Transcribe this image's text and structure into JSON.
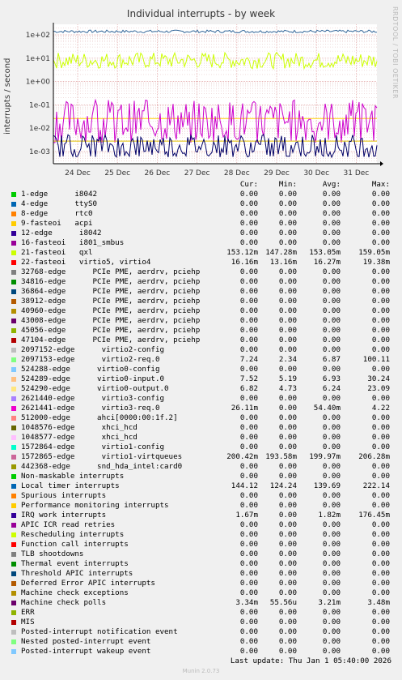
{
  "chart_data": {
    "type": "line",
    "title": "Individual interrupts - by week",
    "ylabel": "interrupts / second",
    "yscale": "log",
    "ylim": [
      0.0006,
      0.3
    ],
    "yticks": [
      "1e+02",
      "1e+01",
      "1e+00",
      "1e-01",
      "1e-02",
      "1e-03"
    ],
    "xticks": [
      "24 Dec",
      "25 Dec",
      "26 Dec",
      "27 Dec",
      "28 Dec",
      "29 Dec",
      "30 Dec",
      "31 Dec"
    ],
    "series": [
      {
        "name": "Local timer interrupts",
        "color": "#336699",
        "level": 140,
        "noise": 0.06
      },
      {
        "name": "21-fasteoi qxl",
        "color": "#ccff00",
        "level": 8,
        "noise": 0.35
      },
      {
        "name": "2621441-edge virtio3-req.0",
        "color": "#ffcc00",
        "level": 0.026,
        "noise": 0
      },
      {
        "name": "1572865-edge virtio1-virtqueues",
        "color": "#cc00cc",
        "level": 0.02,
        "noise": 0.9
      },
      {
        "name": "2621440-edge virtio3-config",
        "color": "#e4c200",
        "level": 0.0028,
        "noise": 0
      },
      {
        "name": "IRQ work interrupts",
        "color": "#000066",
        "level": 0.0018,
        "noise": 0.5
      }
    ]
  },
  "side_label": "RRDTOOL / TOBI OETIKER",
  "headers": {
    "cur": "Cur:",
    "min": "Min:",
    "avg": "Avg:",
    "max": "Max:"
  },
  "rows": [
    {
      "label": "1-edge      i8042",
      "color": "#00cc00",
      "cur": "0.00",
      "min": "0.00",
      "avg": "0.00",
      "max": "0.00"
    },
    {
      "label": "4-edge      ttyS0",
      "color": "#0066b3",
      "cur": "0.00",
      "min": "0.00",
      "avg": "0.00",
      "max": "0.00"
    },
    {
      "label": "8-edge      rtc0",
      "color": "#ff8000",
      "cur": "0.00",
      "min": "0.00",
      "avg": "0.00",
      "max": "0.00"
    },
    {
      "label": "9-fasteoi   acpi",
      "color": "#ffcc00",
      "cur": "0.00",
      "min": "0.00",
      "avg": "0.00",
      "max": "0.00"
    },
    {
      "label": "12-edge      i8042",
      "color": "#330099",
      "cur": "0.00",
      "min": "0.00",
      "avg": "0.00",
      "max": "0.00"
    },
    {
      "label": "16-fasteoi   i801_smbus",
      "color": "#990099",
      "cur": "0.00",
      "min": "0.00",
      "avg": "0.00",
      "max": "0.00"
    },
    {
      "label": "21-fasteoi   qxl",
      "color": "#ccff00",
      "cur": "153.12m",
      "min": "147.28m",
      "avg": "153.05m",
      "max": "159.05m"
    },
    {
      "label": "22-fasteoi   virtio5, virtio4",
      "color": "#ff0000",
      "cur": "16.16m",
      "min": "13.16m",
      "avg": "16.27m",
      "max": "19.38m"
    },
    {
      "label": "32768-edge      PCIe PME, aerdrv, pciehp",
      "color": "#808080",
      "cur": "0.00",
      "min": "0.00",
      "avg": "0.00",
      "max": "0.00"
    },
    {
      "label": "34816-edge      PCIe PME, aerdrv, pciehp",
      "color": "#008f00",
      "cur": "0.00",
      "min": "0.00",
      "avg": "0.00",
      "max": "0.00"
    },
    {
      "label": "36864-edge      PCIe PME, aerdrv, pciehp",
      "color": "#00487d",
      "cur": "0.00",
      "min": "0.00",
      "avg": "0.00",
      "max": "0.00"
    },
    {
      "label": "38912-edge      PCIe PME, aerdrv, pciehp",
      "color": "#b35a00",
      "cur": "0.00",
      "min": "0.00",
      "avg": "0.00",
      "max": "0.00"
    },
    {
      "label": "40960-edge      PCIe PME, aerdrv, pciehp",
      "color": "#b38f00",
      "cur": "0.00",
      "min": "0.00",
      "avg": "0.00",
      "max": "0.00"
    },
    {
      "label": "43008-edge      PCIe PME, aerdrv, pciehp",
      "color": "#6b006b",
      "cur": "0.00",
      "min": "0.00",
      "avg": "0.00",
      "max": "0.00"
    },
    {
      "label": "45056-edge      PCIe PME, aerdrv, pciehp",
      "color": "#8fb300",
      "cur": "0.00",
      "min": "0.00",
      "avg": "0.00",
      "max": "0.00"
    },
    {
      "label": "47104-edge      PCIe PME, aerdrv, pciehp",
      "color": "#b30000",
      "cur": "0.00",
      "min": "0.00",
      "avg": "0.00",
      "max": "0.00"
    },
    {
      "label": "2097152-edge      virtio2-config",
      "color": "#bebebe",
      "cur": "0.00",
      "min": "0.00",
      "avg": "0.00",
      "max": "0.00"
    },
    {
      "label": "2097153-edge      virtio2-req.0",
      "color": "#80ff80",
      "cur": "7.24",
      "min": "2.34",
      "avg": "6.87",
      "max": "100.11"
    },
    {
      "label": "524288-edge      virtio0-config",
      "color": "#80c9ff",
      "cur": "0.00",
      "min": "0.00",
      "avg": "0.00",
      "max": "0.00"
    },
    {
      "label": "524289-edge      virtio0-input.0",
      "color": "#ffc080",
      "cur": "7.52",
      "min": "5.19",
      "avg": "6.93",
      "max": "30.24"
    },
    {
      "label": "524290-edge      virtio0-output.0",
      "color": "#ffe680",
      "cur": "6.82",
      "min": "4.73",
      "avg": "6.24",
      "max": "23.09"
    },
    {
      "label": "2621440-edge      virtio3-config",
      "color": "#aa80ff",
      "cur": "0.00",
      "min": "0.00",
      "avg": "0.00",
      "max": "0.00"
    },
    {
      "label": "2621441-edge      virtio3-req.0",
      "color": "#ee00cc",
      "cur": "26.11m",
      "min": "0.00",
      "avg": "54.40m",
      "max": "4.22"
    },
    {
      "label": "512000-edge      ahci[0000:00:1f.2]",
      "color": "#ff8080",
      "cur": "0.00",
      "min": "0.00",
      "avg": "0.00",
      "max": "0.00"
    },
    {
      "label": "1048576-edge      xhci_hcd",
      "color": "#666600",
      "cur": "0.00",
      "min": "0.00",
      "avg": "0.00",
      "max": "0.00"
    },
    {
      "label": "1048577-edge      xhci_hcd",
      "color": "#ffbfff",
      "cur": "0.00",
      "min": "0.00",
      "avg": "0.00",
      "max": "0.00"
    },
    {
      "label": "1572864-edge      virtio1-config",
      "color": "#00ffcc",
      "cur": "0.00",
      "min": "0.00",
      "avg": "0.00",
      "max": "0.00"
    },
    {
      "label": "1572865-edge      virtio1-virtqueues",
      "color": "#cc6699",
      "cur": "200.42m",
      "min": "193.58m",
      "avg": "199.97m",
      "max": "206.28m"
    },
    {
      "label": "442368-edge      snd_hda_intel:card0",
      "color": "#999900",
      "cur": "0.00",
      "min": "0.00",
      "avg": "0.00",
      "max": "0.00"
    },
    {
      "label": "Non-maskable interrupts",
      "color": "#00cc00",
      "cur": "0.00",
      "min": "0.00",
      "avg": "0.00",
      "max": "0.00"
    },
    {
      "label": "Local timer interrupts",
      "color": "#0066b3",
      "cur": "144.12",
      "min": "124.24",
      "avg": "139.69",
      "max": "222.14"
    },
    {
      "label": "Spurious interrupts",
      "color": "#ff8000",
      "cur": "0.00",
      "min": "0.00",
      "avg": "0.00",
      "max": "0.00"
    },
    {
      "label": "Performance monitoring interrupts",
      "color": "#ffcc00",
      "cur": "0.00",
      "min": "0.00",
      "avg": "0.00",
      "max": "0.00"
    },
    {
      "label": "IRQ work interrupts",
      "color": "#330099",
      "cur": "1.67m",
      "min": "0.00",
      "avg": "1.82m",
      "max": "176.45m"
    },
    {
      "label": "APIC ICR read retries",
      "color": "#990099",
      "cur": "0.00",
      "min": "0.00",
      "avg": "0.00",
      "max": "0.00"
    },
    {
      "label": "Rescheduling interrupts",
      "color": "#ccff00",
      "cur": "0.00",
      "min": "0.00",
      "avg": "0.00",
      "max": "0.00"
    },
    {
      "label": "Function call interrupts",
      "color": "#ff0000",
      "cur": "0.00",
      "min": "0.00",
      "avg": "0.00",
      "max": "0.00"
    },
    {
      "label": "TLB shootdowns",
      "color": "#808080",
      "cur": "0.00",
      "min": "0.00",
      "avg": "0.00",
      "max": "0.00"
    },
    {
      "label": "Thermal event interrupts",
      "color": "#008f00",
      "cur": "0.00",
      "min": "0.00",
      "avg": "0.00",
      "max": "0.00"
    },
    {
      "label": "Threshold APIC interrupts",
      "color": "#00487d",
      "cur": "0.00",
      "min": "0.00",
      "avg": "0.00",
      "max": "0.00"
    },
    {
      "label": "Deferred Error APIC interrupts",
      "color": "#b35a00",
      "cur": "0.00",
      "min": "0.00",
      "avg": "0.00",
      "max": "0.00"
    },
    {
      "label": "Machine check exceptions",
      "color": "#b38f00",
      "cur": "0.00",
      "min": "0.00",
      "avg": "0.00",
      "max": "0.00"
    },
    {
      "label": "Machine check polls",
      "color": "#6b006b",
      "cur": "3.34m",
      "min": "55.56u",
      "avg": "3.21m",
      "max": "3.48m"
    },
    {
      "label": "ERR",
      "color": "#8fb300",
      "cur": "0.00",
      "min": "0.00",
      "avg": "0.00",
      "max": "0.00"
    },
    {
      "label": "MIS",
      "color": "#b30000",
      "cur": "0.00",
      "min": "0.00",
      "avg": "0.00",
      "max": "0.00"
    },
    {
      "label": "Posted-interrupt notification event",
      "color": "#bebebe",
      "cur": "0.00",
      "min": "0.00",
      "avg": "0.00",
      "max": "0.00"
    },
    {
      "label": "Nested posted-interrupt event",
      "color": "#80ff80",
      "cur": "0.00",
      "min": "0.00",
      "avg": "0.00",
      "max": "0.00"
    },
    {
      "label": "Posted-interrupt wakeup event",
      "color": "#80c9ff",
      "cur": "0.00",
      "min": "0.00",
      "avg": "0.00",
      "max": "0.00"
    }
  ],
  "last_update": "Last update: Thu Jan  1 05:40:00 2026",
  "footer": "Munin 2.0.73"
}
